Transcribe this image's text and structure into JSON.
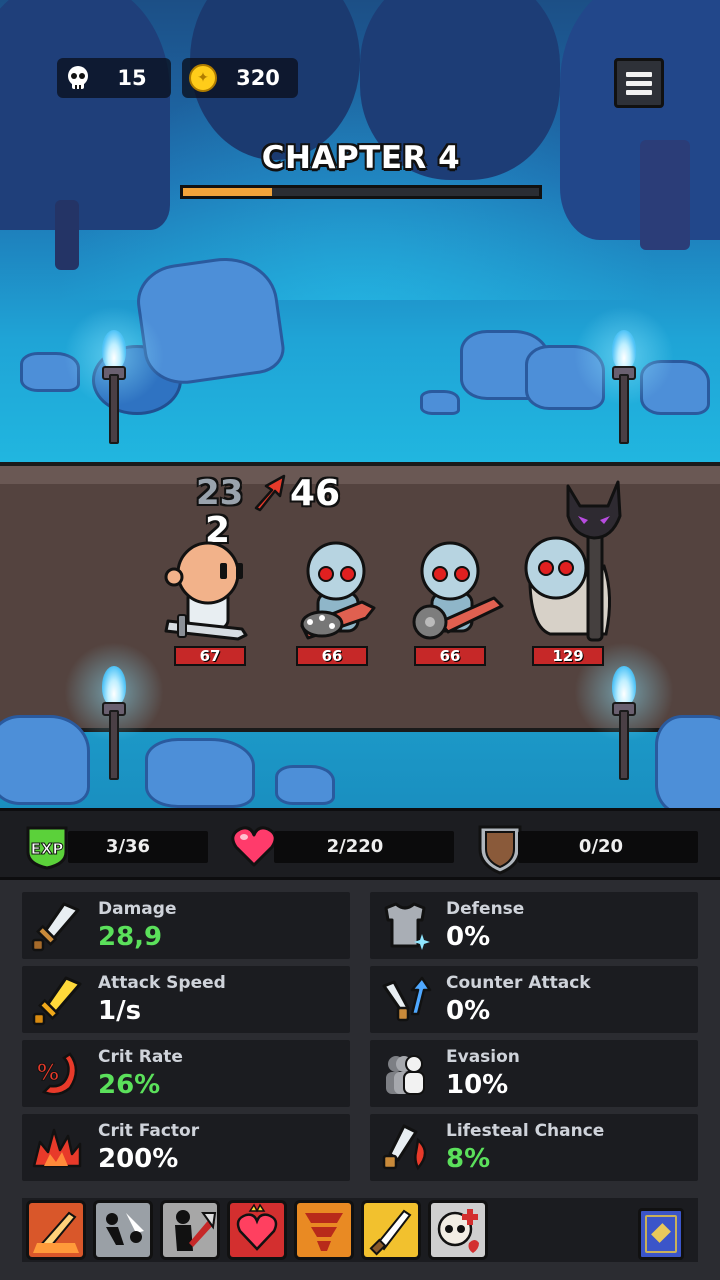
{
  "hud": {
    "kills": "15",
    "coins": "320",
    "coin_symbol": "✦"
  },
  "chapter": {
    "title": "CHAPTER 4",
    "progress": 0.25
  },
  "battle": {
    "damage_numbers": {
      "dealt_grey": "23",
      "crit": "46",
      "taken": "2"
    },
    "units": [
      {
        "name": "hero",
        "hp": "67",
        "hp_fraction": 1.0
      },
      {
        "name": "skeleton-club-1",
        "hp": "66",
        "hp_fraction": 1.0
      },
      {
        "name": "skeleton-club-2",
        "hp": "66",
        "hp_fraction": 1.0
      },
      {
        "name": "skeleton-shaman",
        "hp": "129",
        "hp_fraction": 1.0
      }
    ]
  },
  "resources": {
    "exp": {
      "label": "EXP",
      "value": "3/36",
      "color": "#5bd13a"
    },
    "health": {
      "value": "2/220",
      "color": "#ff3b6b"
    },
    "armor": {
      "value": "0/20",
      "color": "#8a5a3a"
    }
  },
  "stats": [
    {
      "label": "Damage",
      "value": "28,9",
      "highlight": true,
      "icon": "sword-icon"
    },
    {
      "label": "Defense",
      "value": "0%",
      "highlight": false,
      "icon": "armor-icon"
    },
    {
      "label": "Attack Speed",
      "value": "1/s",
      "highlight": false,
      "icon": "golden-sword-icon"
    },
    {
      "label": "Counter Attack",
      "value": "0%",
      "highlight": false,
      "icon": "counter-attack-icon"
    },
    {
      "label": "Crit Rate",
      "value": "26%",
      "highlight": true,
      "icon": "crit-rate-icon"
    },
    {
      "label": "Evasion",
      "value": "10%",
      "highlight": false,
      "icon": "evasion-icon"
    },
    {
      "label": "Crit Factor",
      "value": "200%",
      "highlight": false,
      "icon": "crit-factor-icon"
    },
    {
      "label": "Lifesteal Chance",
      "value": "8%",
      "highlight": true,
      "icon": "lifesteal-icon"
    }
  ],
  "skills": [
    {
      "name": "flaming-sword-skill",
      "color": "#d9572a"
    },
    {
      "name": "dash-strike-skill",
      "color": "#9aa0a6"
    },
    {
      "name": "axe-strike-skill",
      "color": "#a7a7a7"
    },
    {
      "name": "royal-heart-skill",
      "color": "#d32f2f"
    },
    {
      "name": "fire-tornado-skill",
      "color": "#e98a23"
    },
    {
      "name": "golden-dagger-skill",
      "color": "#f2c12e"
    },
    {
      "name": "skull-heal-skill",
      "color": "#cfcfcf"
    }
  ],
  "colors": {
    "accent_green": "#5be05b",
    "hp_red": "#c62828",
    "chapter_progress": "#f2a33a"
  }
}
